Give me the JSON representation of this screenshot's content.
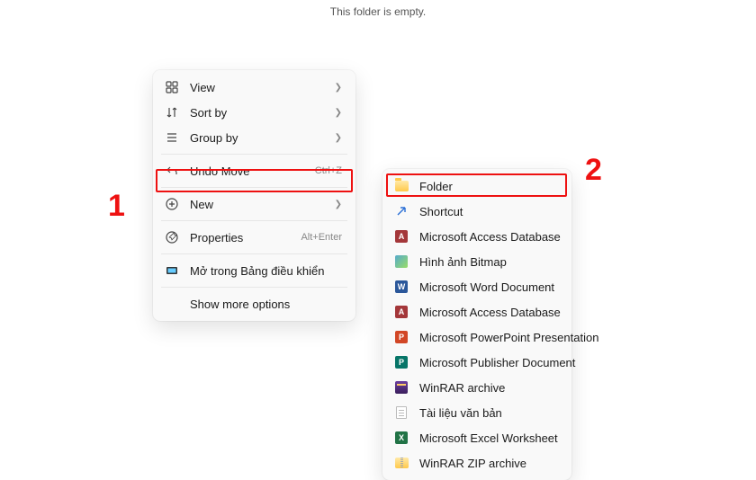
{
  "empty_message": "This folder is empty.",
  "annotations": {
    "one": "1",
    "two": "2"
  },
  "main_menu": {
    "view": {
      "label": "View"
    },
    "sort_by": {
      "label": "Sort by"
    },
    "group_by": {
      "label": "Group by"
    },
    "undo_move": {
      "label": "Undo Move",
      "shortcut": "Ctrl+Z"
    },
    "new": {
      "label": "New"
    },
    "properties": {
      "label": "Properties",
      "shortcut": "Alt+Enter"
    },
    "control_panel": {
      "label": "Mở trong Bảng điều khiển"
    },
    "show_more": {
      "label": "Show more options"
    }
  },
  "new_submenu": {
    "folder": {
      "label": "Folder"
    },
    "shortcut": {
      "label": "Shortcut"
    },
    "access1": {
      "label": "Microsoft Access Database"
    },
    "bitmap": {
      "label": "Hình ảnh Bitmap"
    },
    "word": {
      "label": "Microsoft Word Document"
    },
    "access2": {
      "label": "Microsoft Access Database"
    },
    "powerpoint": {
      "label": "Microsoft PowerPoint Presentation"
    },
    "publisher": {
      "label": "Microsoft Publisher Document"
    },
    "winrar": {
      "label": "WinRAR archive"
    },
    "text": {
      "label": "Tài liệu văn bản"
    },
    "excel": {
      "label": "Microsoft Excel Worksheet"
    },
    "winrar_zip": {
      "label": "WinRAR ZIP archive"
    }
  }
}
